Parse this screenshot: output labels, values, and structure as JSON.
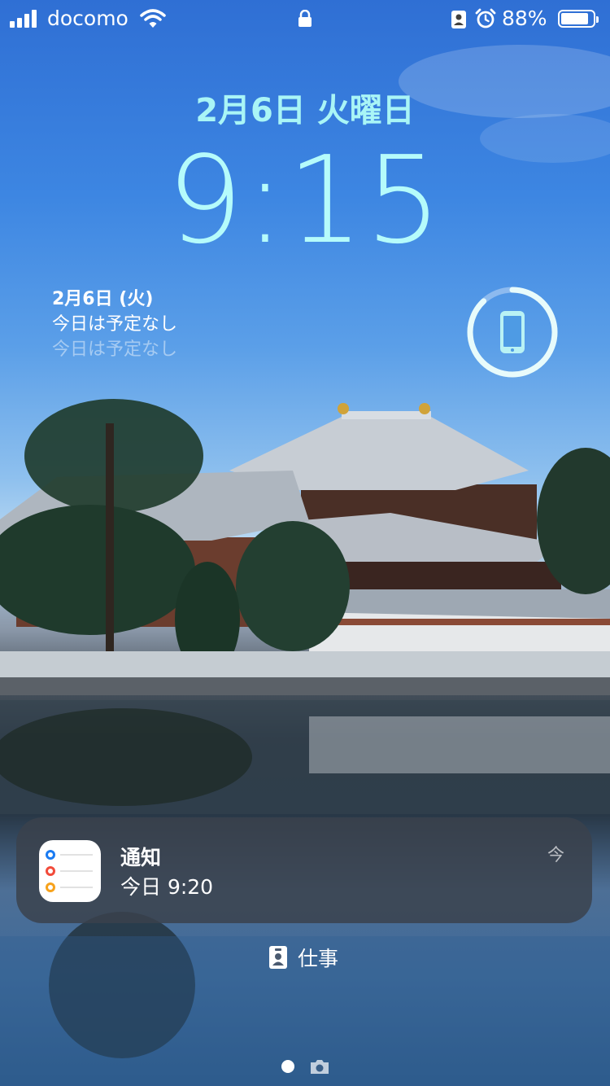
{
  "status_bar": {
    "carrier": "docomo",
    "battery_percent": "88%",
    "battery_level": 0.88,
    "signal_bars": 4,
    "icons": [
      "signal-icon",
      "wifi-icon",
      "lock-icon",
      "portrait-orientation-icon",
      "alarm-icon",
      "battery-icon"
    ]
  },
  "lock_screen": {
    "date": "2月6日 火曜日",
    "time": "9:15"
  },
  "calendar_widget": {
    "date": "2月6日 (火)",
    "line1": "今日は予定なし",
    "line2": "今日は予定なし"
  },
  "battery_widget": {
    "icon": "iphone-icon",
    "level": 0.88
  },
  "notification": {
    "app_icon": "reminders-icon",
    "title": "通知",
    "body": "今日 9:20",
    "timestamp": "今"
  },
  "focus": {
    "icon": "work-focus-icon",
    "label": "仕事"
  },
  "page_indicator": {
    "items": [
      "dot",
      "camera-icon"
    ]
  },
  "colors": {
    "time": "#b5fbfb",
    "date": "#a9f5f6"
  }
}
